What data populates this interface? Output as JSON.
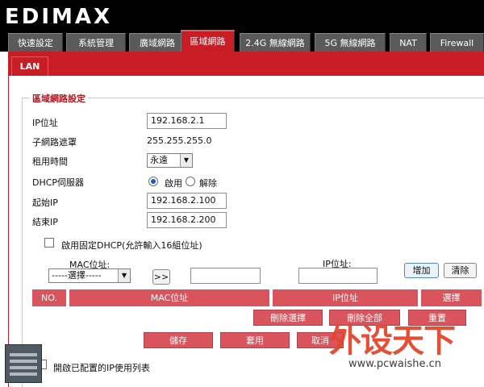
{
  "brand": {
    "logo": "EDIMAX"
  },
  "tabs": [
    {
      "label": "快速設定"
    },
    {
      "label": "系統管理"
    },
    {
      "label": "廣域網路"
    },
    {
      "label": "區域網路"
    },
    {
      "label": "2.4G 無線網路"
    },
    {
      "label": "5G 無線網路"
    },
    {
      "label": "NAT"
    },
    {
      "label": "Firewall"
    }
  ],
  "subtab": {
    "label": "LAN"
  },
  "section": {
    "legend": "區域網路設定"
  },
  "form": {
    "ip_label": "IP位址",
    "ip_value": "192.168.2.1",
    "mask_label": "子網路遮罩",
    "mask_value": "255.255.255.0",
    "lease_label": "租用時間",
    "lease_value": "永遠",
    "dhcp_label": "DHCP伺服器",
    "dhcp_on": "啟用",
    "dhcp_off": "解除",
    "start_label": "起始IP",
    "start_value": "192.168.2.100",
    "end_label": "結束IP",
    "end_value": "192.168.2.200"
  },
  "static_dhcp": {
    "enable_label": "啟用固定DHCP(允許輸入16組位址)",
    "mac_label": "MAC位址:",
    "select_value": "-----選擇-----",
    "transfer_label": ">>",
    "ip_label": "IP位址:",
    "add_label": "增加",
    "clear_label": "清除"
  },
  "table": {
    "headers": [
      "NO.",
      "MAC位址",
      "IP位址",
      "選擇"
    ]
  },
  "actions": {
    "delete_selected": "刪除選擇",
    "delete_all": "刪除全部",
    "reset": "重置",
    "save": "儲存",
    "apply": "套用",
    "cancel": "取消"
  },
  "ip_list": {
    "label": "開啟已配置的IP使用列表"
  },
  "watermark": {
    "text": "外设天下",
    "url": "www.pcwaishe.cn"
  }
}
